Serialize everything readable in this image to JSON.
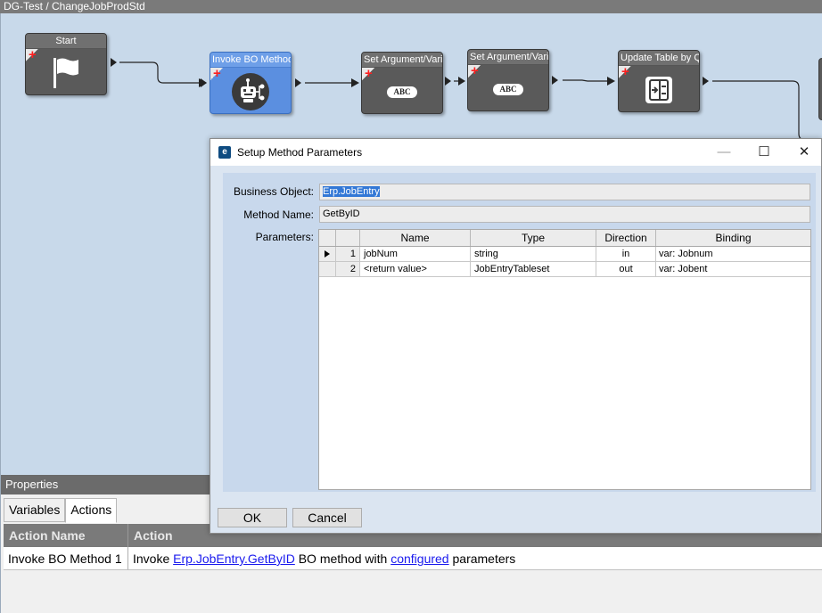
{
  "window": {
    "title": "DG-Test / ChangeJobProdStd"
  },
  "workflow": {
    "nodes": [
      {
        "title": "Start",
        "icon": "flag-icon"
      },
      {
        "title": "Invoke BO Method",
        "icon": "robot-icon"
      },
      {
        "title": "Set Argument/Vari",
        "icon": "abc-icon",
        "badge": "ABC"
      },
      {
        "title": "Set Argument/Vari",
        "icon": "abc-icon",
        "badge": "ABC"
      },
      {
        "title": "Update Table by Q",
        "icon": "table-update-icon"
      }
    ]
  },
  "properties": {
    "header": "Properties",
    "tabs": [
      {
        "label": "Variables"
      },
      {
        "label": "Actions"
      }
    ],
    "columns": {
      "name": "Action Name",
      "action": "Action"
    },
    "rows": [
      {
        "name": "Invoke BO Method 1",
        "prefix": "Invoke ",
        "link1": "Erp.JobEntry.GetByID",
        "middle": " BO method with ",
        "link2": "configured",
        "suffix": " parameters"
      }
    ]
  },
  "dialog": {
    "title": "Setup Method Parameters",
    "app_icon_glyph": "e",
    "window_buttons": {
      "minimize": "—",
      "maximize": "☐",
      "close": "✕"
    },
    "business_object": {
      "label": "Business Object:",
      "value": "Erp.JobEntry"
    },
    "method_name": {
      "label": "Method Name:",
      "value": "GetByID"
    },
    "parameters_label": "Parameters:",
    "grid": {
      "columns": {
        "name": "Name",
        "type": "Type",
        "direction": "Direction",
        "binding": "Binding"
      },
      "rows": [
        {
          "num": "1",
          "name": "jobNum",
          "type": "string",
          "direction": "in",
          "binding": "var: Jobnum"
        },
        {
          "num": "2",
          "name": "<return value>",
          "type": "JobEntryTableset",
          "direction": "out",
          "binding": "var: Jobent"
        }
      ]
    },
    "ok_label": "OK",
    "cancel_label": "Cancel"
  }
}
